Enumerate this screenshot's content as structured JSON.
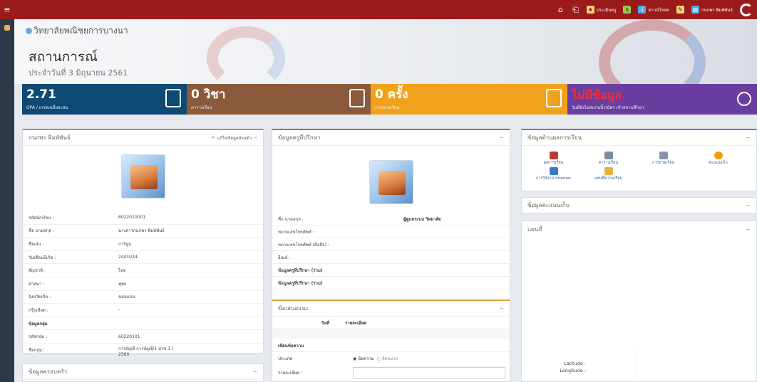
{
  "topbar": {
    "tools": [
      {
        "label": "",
        "icon": "home-icon"
      },
      {
        "label": "",
        "icon": "logout-icon"
      },
      {
        "label": "ประเมินครู",
        "icon": "evaluate-icon"
      },
      {
        "label": "",
        "icon": "money-icon"
      },
      {
        "label": "ดาวน์โหลด",
        "icon": "download-icon"
      },
      {
        "label": "",
        "icon": "pencil-icon"
      },
      {
        "label": "กนกพร พิมพ์พันธ์",
        "icon": "user-card-icon"
      }
    ]
  },
  "header": {
    "school": "วิทยาลัยพณิชยการบางนา",
    "title": "สถานการณ์",
    "date": "ประจำวันที่ 3 มิถุนายน 2561"
  },
  "tiles": [
    {
      "num": "2.71",
      "label": "GPA / เกรดเฉลี่ยสะสม"
    },
    {
      "num": "0 วิชา",
      "label": "ตารางเรียน"
    },
    {
      "num": "0 ครั้ง",
      "label": "การขาดเรียน"
    },
    {
      "num": "ไม่มีข้อมูล",
      "label": "วันที่ยังไม่สแกนนิ้ว/บัตร เข้าสถานศึกษา"
    }
  ],
  "student": {
    "title": "กนกพร พิมพ์พันธ์",
    "edit": "แก้ไขข้อมูลส่วนตัว",
    "rows": [
      {
        "k": "รหัสนักเรียน :",
        "v": "6022010001"
      },
      {
        "k": "ชื่อ นามสกุล :",
        "v": "นางสาวกนกพร พิมพ์พันธ์"
      },
      {
        "k": "ชื่อเล่น :",
        "v": "การ์ตูน"
      },
      {
        "k": "วันเดือนปีเกิด :",
        "v": "24/03/44"
      },
      {
        "k": "สัญชาติ :",
        "v": "ไทย"
      },
      {
        "k": "ศาสนา :",
        "v": "พุทธ"
      },
      {
        "k": "จังหวัดเกิด :",
        "v": "ขอนแก่น"
      },
      {
        "k": "กรุ๊ปเลือด :",
        "v": "-"
      },
      {
        "k": "ข้อมูลกลุ่ม",
        "v": ""
      },
      {
        "k": "รหัสกลุ่ม :",
        "v": "60220101"
      },
      {
        "k": "ชื่อกลุ่ม :",
        "v": "การบัญชี การบัญชี/1 ปวช.1 | 2560"
      }
    ],
    "family_title": "ข้อมูลครอบครัว"
  },
  "advisor": {
    "title": "ข้อมูลครูที่ปรึกษา",
    "rows": [
      {
        "k": "ชื่อ นามสกุล :",
        "v": "ผู้ดูแลระบบ วิทยาลัย"
      },
      {
        "k": "หมายเลขโทรศัพท์ :",
        "v": ""
      },
      {
        "k": "หมายเลขโทรศัพท์ (มือถือ) :",
        "v": ""
      },
      {
        "k": "อีเมล์ :",
        "v": ""
      },
      {
        "k": "ข้อมูลครูที่ปรึกษา (ร่วม)",
        "v": ""
      },
      {
        "k": "ข้อมูลครูที่ปรึกษา (ร่วม)",
        "v": ""
      }
    ]
  },
  "suggest": {
    "title": "ข้อเสนอแนะ",
    "col1": "วันที่",
    "col2": "รายละเอียด",
    "write": "เขียนข้อความ",
    "type_label": "ประเภท",
    "type_opt1": "ข้อความ",
    "type_opt2": "จัดหมาย",
    "detail_label": "รายละเอียด :"
  },
  "results": {
    "title": "ข้อมูลด้านผลการเรียน",
    "items": [
      {
        "label": "ผลการเรียน",
        "color": "#c0392b"
      },
      {
        "label": "ตารางเรียน",
        "color": "#7f8c9d"
      },
      {
        "label": "การขาดเรียน",
        "color": "#8a95a3"
      },
      {
        "label": "คะแนนเก็บ",
        "color": "#f39c12"
      },
      {
        "label": "การใช้งาน Internet",
        "color": "#3b79c3"
      },
      {
        "label": "แผนที่ความเรียน",
        "color": "#e2b23c"
      }
    ]
  },
  "scores": {
    "title": "ข้อมูลคะแนนเก็บ"
  },
  "map": {
    "title": "แผนที่",
    "lat_label": "Latitude :",
    "lng_label": "Longitude :"
  },
  "colors": {
    "topbar": "#9b1b1b",
    "gpa": "#0f4a75",
    "subjects": "#8a5a3a",
    "absence": "#f0a21c",
    "scan": "#6a3ea0"
  }
}
